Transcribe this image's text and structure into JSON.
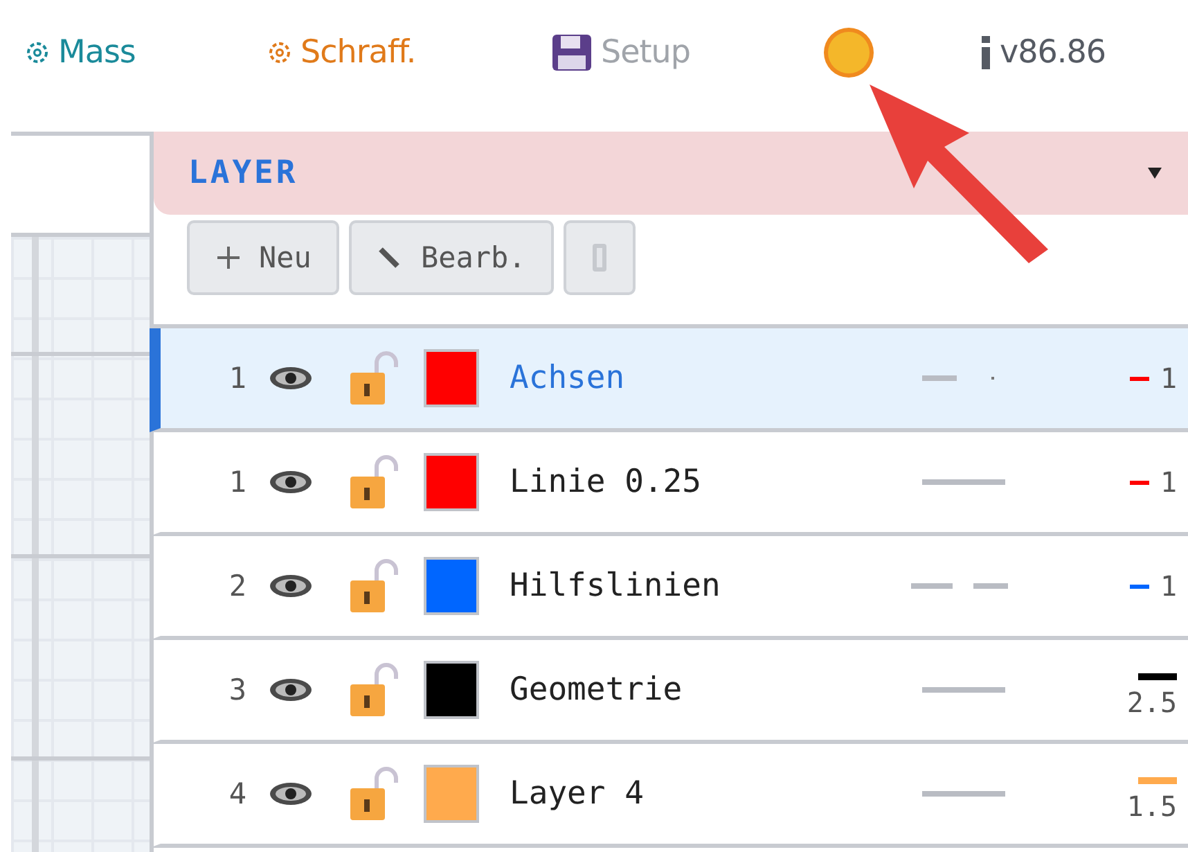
{
  "toolbar": [
    {
      "kind": "gear",
      "label": "Mass",
      "color": "#1a8a9a"
    },
    {
      "kind": "gear",
      "label": "Schraff.",
      "color": "#e07a1a"
    },
    {
      "kind": "floppy",
      "label": "Setup",
      "color": "#a0a4aa"
    },
    {
      "kind": "sun"
    },
    {
      "kind": "info",
      "label": "v86.86",
      "color": "#555a63"
    }
  ],
  "panel": {
    "title": "LAYER",
    "buttons": [
      {
        "kind": "plus",
        "label": "Neu"
      },
      {
        "kind": "pencil",
        "label": "Bearb."
      },
      {
        "kind": "trash"
      }
    ]
  },
  "layers": [
    {
      "number": "1",
      "name": "Achsen",
      "color": "#ff0000",
      "line_style": {
        "kind": "dashdot"
      },
      "line_width": {
        "kind": "inline",
        "label": "1"
      },
      "selected": true
    },
    {
      "number": "1",
      "name": "Linie 0.25",
      "color": "#ff0000",
      "line_style": {
        "kind": "solid"
      },
      "line_width": {
        "kind": "inline",
        "label": "1"
      },
      "selected": false
    },
    {
      "number": "2",
      "name": "Hilfslinien",
      "color": "#0066ff",
      "line_style": {
        "kind": "dashed"
      },
      "line_width": {
        "kind": "inline",
        "label": "1"
      },
      "selected": false
    },
    {
      "number": "3",
      "name": "Geometrie",
      "color": "#000000",
      "line_style": {
        "kind": "solid"
      },
      "line_width": {
        "kind": "stacked",
        "label": "2.5"
      },
      "selected": false
    },
    {
      "number": "4",
      "name": "Layer 4",
      "color": "#ffaa4d",
      "line_style": {
        "kind": "solid"
      },
      "line_width": {
        "kind": "stacked",
        "label": "1.5"
      },
      "selected": false
    }
  ]
}
